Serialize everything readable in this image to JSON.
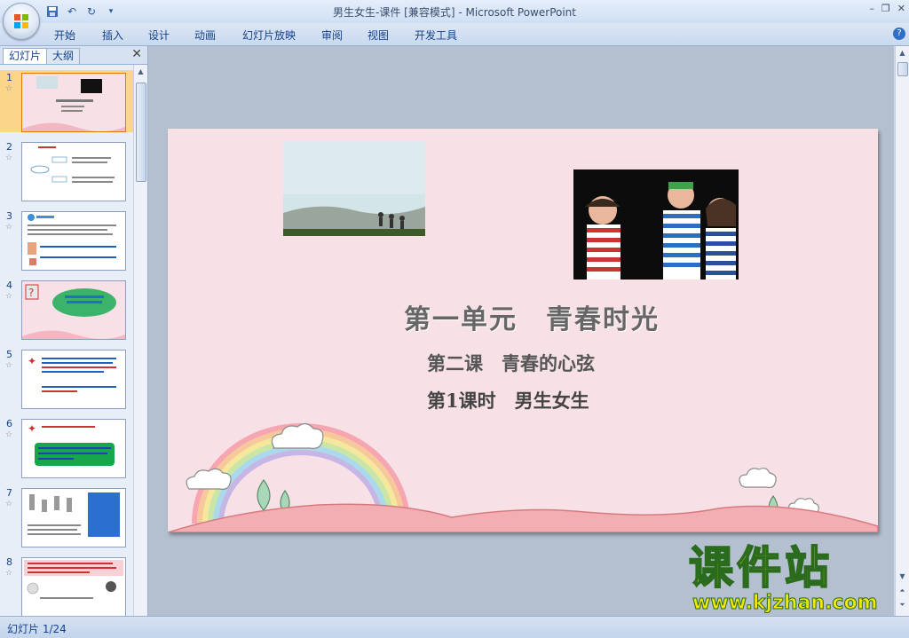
{
  "window": {
    "title": "男生女生-课件 [兼容模式] - Microsoft PowerPoint"
  },
  "ribbon": {
    "tabs": [
      "开始",
      "插入",
      "设计",
      "动画",
      "幻灯片放映",
      "审阅",
      "视图",
      "开发工具"
    ]
  },
  "panel": {
    "tab_slides": "幻灯片",
    "tab_outline": "大纲",
    "thumbnails": [
      {
        "num": "1"
      },
      {
        "num": "2"
      },
      {
        "num": "3"
      },
      {
        "num": "4"
      },
      {
        "num": "5"
      },
      {
        "num": "6"
      },
      {
        "num": "7"
      },
      {
        "num": "8"
      }
    ]
  },
  "slide": {
    "title": "第一单元　青春时光",
    "lesson": "第二课　青春的心弦",
    "period": "第1课时　男生女生"
  },
  "status": {
    "slide_counter": "幻灯片 1/24"
  },
  "watermark": {
    "brand": "课件站",
    "url": "www.kjzhan.com"
  },
  "colors": {
    "selected_thumb": "#fbd58a",
    "slide_bg": "#f7e1e6",
    "ribbon_text": "#15428b"
  }
}
